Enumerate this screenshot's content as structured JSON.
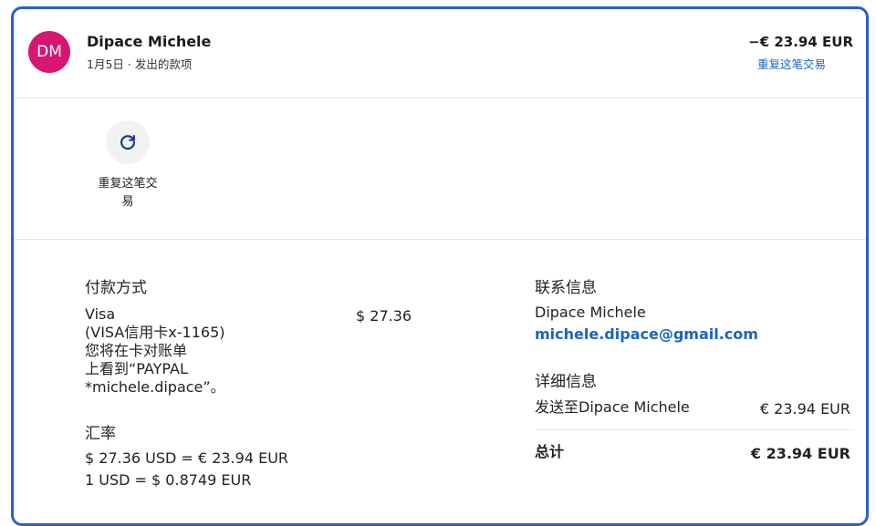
{
  "header": {
    "avatar_initials": "DM",
    "name": "Dipace Michele",
    "subtitle": "1月5日 · 发出的款项",
    "amount": "−€ 23.94 EUR",
    "repeat_link": "重复这笔交易"
  },
  "action": {
    "icon": "refresh-icon",
    "label": "重复这笔交易"
  },
  "payment": {
    "title": "付款方式",
    "method_lines": [
      "Visa",
      "(VISA信用卡x-1165)",
      "您将在卡对账单",
      "上看到“PAYPAL",
      "*michele.dipace”。"
    ],
    "amount": "$ 27.36"
  },
  "exchange": {
    "title": "汇率",
    "line1": "$ 27.36 USD = € 23.94 EUR",
    "line2": "1 USD = $ 0.8749 EUR"
  },
  "contact": {
    "title": "联系信息",
    "name": "Dipace Michele",
    "email": "michele.dipace@gmail.com"
  },
  "details_info": {
    "title": "详细信息",
    "send_label": "发送至Dipace Michele",
    "send_amount": "€ 23.94 EUR",
    "total_label": "总计",
    "total_amount": "€ 23.94 EUR"
  },
  "colors": {
    "accent": "#2a5fcb",
    "avatar": "#d7166f",
    "link": "#1a63c6"
  }
}
